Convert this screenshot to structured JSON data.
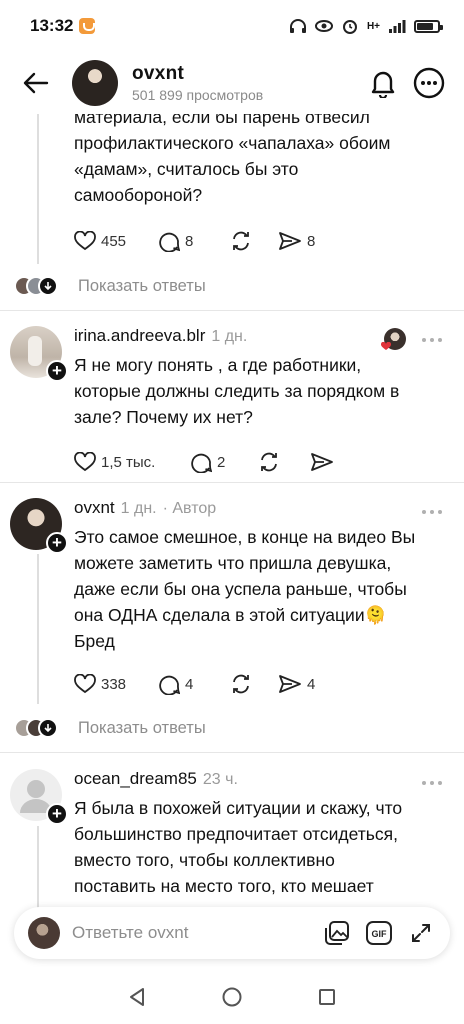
{
  "status": {
    "time": "13:32",
    "network": "H+"
  },
  "header": {
    "username": "ovxnt",
    "views": "501 899 просмотров"
  },
  "first_comment": {
    "lines": [
      "материала, если бы парень отвесил",
      "профилактического «чапалаха» обоим",
      "«дамам», считалось бы это",
      "самообороной?"
    ],
    "likes": "455",
    "replies": "8",
    "shares": "8",
    "show_replies": "Показать ответы"
  },
  "comment2": {
    "username": "irina.andreeva.blr",
    "time": "1 дн.",
    "lines": [
      "Я не могу понять , а где работники,",
      "которые должны следить за порядком в",
      "зале? Почему их нет?"
    ],
    "likes": "1,5 тыс.",
    "replies": "2"
  },
  "comment3": {
    "username": "ovxnt",
    "time": "1 дн.",
    "author_label": "· Автор",
    "lines": [
      "Это самое смешное, в конце на видео Вы",
      "можете заметить что пришла девушка,",
      "даже если бы она успела раньше, чтобы",
      "она ОДНА сделала в этой ситуации",
      "Бред"
    ],
    "emoji": "🫠",
    "likes": "338",
    "replies": "4",
    "shares": "4",
    "show_replies": "Показать ответы"
  },
  "comment4": {
    "username": "ocean_dream85",
    "time": "23 ч.",
    "lines": [
      "Я была в похожей ситуации и скажу, что",
      "большинство предпочитает отсидеться,",
      "вместо того, чтобы коллективно",
      "поставить на место того, кто мешает"
    ]
  },
  "reply_bar": {
    "placeholder": "Ответьте ovxnt"
  },
  "colors": {
    "muted": "#8d8d8d",
    "heart_red": "#e0333a",
    "divider": "#e6e6e6"
  }
}
